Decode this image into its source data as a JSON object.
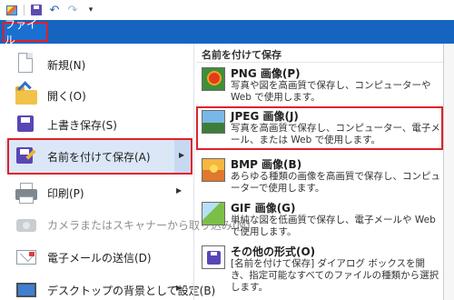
{
  "quick_access": {
    "items": [
      {
        "name": "paint-app-icon"
      },
      {
        "name": "save-icon"
      },
      {
        "name": "undo-icon"
      },
      {
        "name": "redo-icon"
      },
      {
        "name": "customize-menu-icon"
      }
    ],
    "customize_glyph": "▾"
  },
  "ribbon": {
    "file_tab_label": "ファイル"
  },
  "file_menu": {
    "items": [
      {
        "label": "新規(N)",
        "enabled": true
      },
      {
        "label": "開く(O)",
        "enabled": true
      },
      {
        "label": "上書き保存(S)",
        "enabled": true
      },
      {
        "label": "名前を付けて保存(A)",
        "enabled": true,
        "selected": true,
        "has_submenu": true
      },
      {
        "label": "印刷(P)",
        "enabled": true,
        "has_submenu": true
      },
      {
        "label": "カメラまたはスキャナーから取り込み(M)",
        "enabled": false
      },
      {
        "label": "電子メールの送信(D)",
        "enabled": true
      },
      {
        "label": "デスクトップの背景として設定(B)",
        "enabled": true,
        "has_submenu": true
      }
    ],
    "submenu_arrow": "▶"
  },
  "save_as_submenu": {
    "header": "名前を付けて保存",
    "items": [
      {
        "title": "PNG 画像(P)",
        "description": "写真や図を高画質で保存し、コンピューターや Web で使用します。",
        "icon": "png-image-icon"
      },
      {
        "title": "JPEG 画像(J)",
        "description": "写真を高画質で保存し、コンピューター、電子メール、または Web で使用します。",
        "icon": "jpeg-image-icon",
        "highlighted": true
      },
      {
        "title": "BMP 画像(B)",
        "description": "あらゆる種類の画像を高画質で保存し、コンピューターで使用します。",
        "icon": "bmp-image-icon"
      },
      {
        "title": "GIF 画像(G)",
        "description": "単純な図を低画質で保存し、電子メールや Web で使用します。",
        "icon": "gif-image-icon"
      },
      {
        "title": "その他の形式(O)",
        "description": "[名前を付けて保存] ダイアログ ボックスを開き、指定可能なすべてのファイルの種類から選択します。",
        "icon": "other-formats-icon"
      }
    ]
  },
  "colors": {
    "ribbon_blue": "#1565c0",
    "highlight_red": "#e0202a",
    "selection_blue": "#dbe7f7"
  }
}
